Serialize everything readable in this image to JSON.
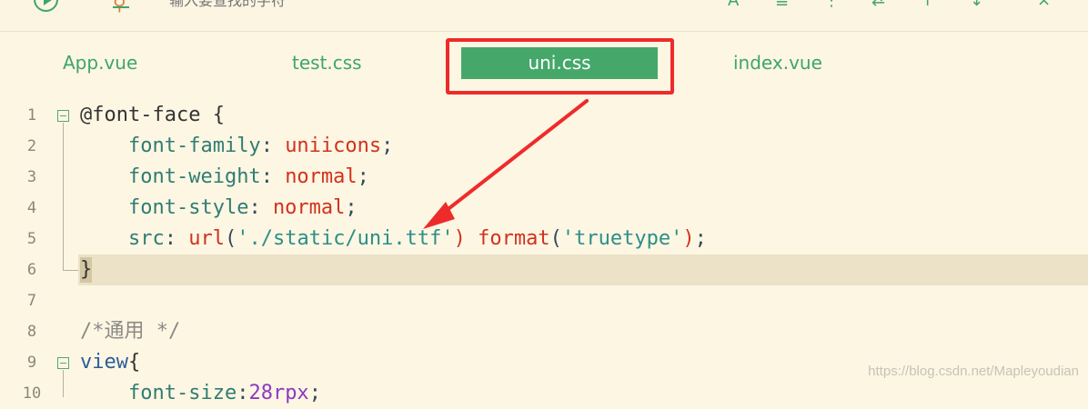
{
  "toolbar": {
    "search_placeholder": "输入要查找的字符",
    "icons": [
      "run-icon",
      "search-icon",
      "match-case-icon",
      "regex-icon",
      "whole-word-icon",
      "replace-icon",
      "prev-icon",
      "next-icon",
      "close-icon"
    ]
  },
  "tabs": [
    {
      "label": "App.vue",
      "active": false
    },
    {
      "label": "test.css",
      "active": false
    },
    {
      "label": "uni.css",
      "active": true
    },
    {
      "label": "index.vue",
      "active": false
    }
  ],
  "editor": {
    "line_numbers": [
      "1",
      "2",
      "3",
      "4",
      "5",
      "6",
      "7",
      "8",
      "9",
      "10"
    ],
    "highlighted_line": "6",
    "lines": [
      {
        "selector": "@font-face",
        "brace": " {"
      },
      {
        "indent": "    ",
        "prop": "font-family",
        "sep": ": ",
        "value": "uniicons",
        "end": ";"
      },
      {
        "indent": "    ",
        "prop": "font-weight",
        "sep": ": ",
        "value": "normal",
        "end": ";"
      },
      {
        "indent": "    ",
        "prop": "font-style",
        "sep": ": ",
        "value": "normal",
        "end": ";"
      },
      {
        "indent": "    ",
        "prop": "src",
        "sep": ": ",
        "fn1": "url",
        "p1": "(",
        "str1": "'./static/uni.ttf'",
        "p2": ")",
        "fn2": "format",
        "p3": "(",
        "str2": "'truetype'",
        "p4": ")",
        "end": ";"
      },
      {
        "brace": "}"
      },
      {
        "text": ""
      },
      {
        "comment": "/*通用 */"
      },
      {
        "selector": "view",
        "brace": "{"
      },
      {
        "indent": "    ",
        "prop": "font-size",
        "sep": ":",
        "value": "28rpx",
        "end": ";"
      }
    ]
  },
  "annotation": {
    "color": "#ee2b2b"
  },
  "watermark": "https://blog.csdn.net/Mapleyoudian"
}
